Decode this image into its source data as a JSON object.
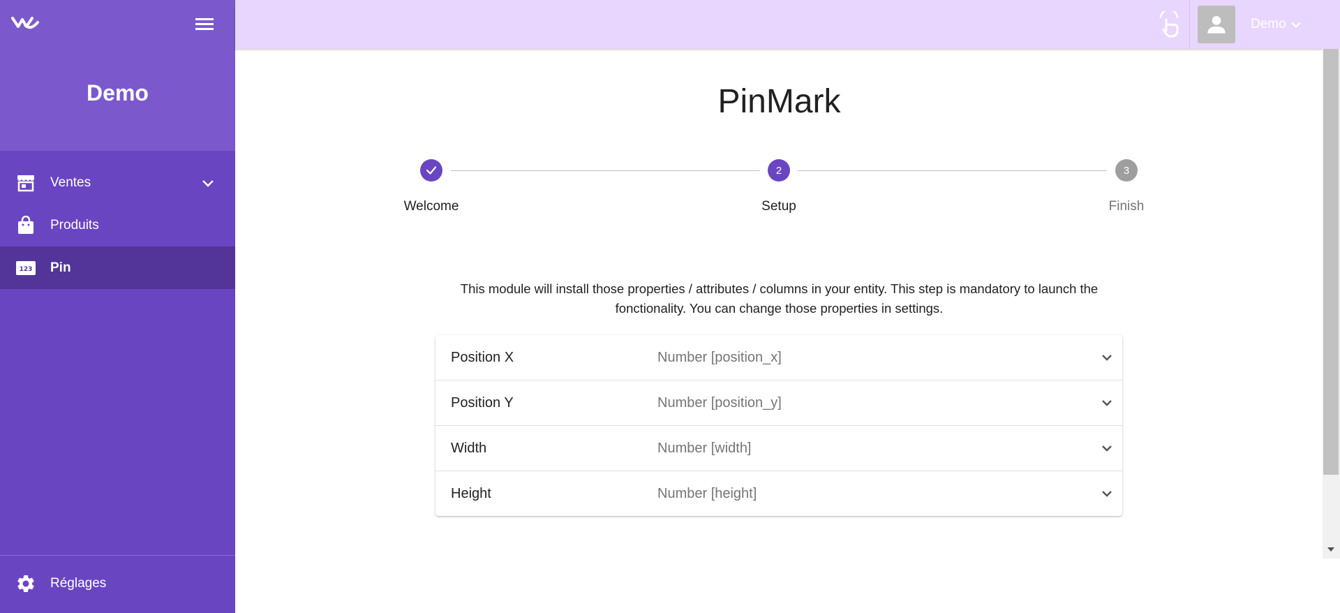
{
  "sidebar": {
    "brand": "Demo",
    "items": [
      {
        "label": "Ventes",
        "icon": "store-icon",
        "expandable": true
      },
      {
        "label": "Produits",
        "icon": "shopping-bag-icon"
      },
      {
        "label": "Pin",
        "icon": "numbers-123-icon",
        "active": true
      }
    ],
    "settings_label": "Réglages"
  },
  "topbar": {
    "user_name": "Demo"
  },
  "page": {
    "title": "PinMark"
  },
  "stepper": {
    "steps": [
      {
        "label": "Welcome",
        "state": "done"
      },
      {
        "label": "Setup",
        "number": "2",
        "state": "current"
      },
      {
        "label": "Finish",
        "number": "3",
        "state": "pending"
      }
    ]
  },
  "intro_text": "This module will install those properties / attributes / columns in your entity. This step is mandatory to launch the fonctionality. You can change those properties in settings.",
  "properties": [
    {
      "name": "Position X",
      "value": "Number [position_x]"
    },
    {
      "name": "Position Y",
      "value": "Number [position_y]"
    },
    {
      "name": "Width",
      "value": "Number [width]"
    },
    {
      "name": "Height",
      "value": "Number [height]"
    }
  ],
  "colors": {
    "sidebar": "#6a45c2",
    "sidebar_header": "#7b59cc",
    "sidebar_active": "#533599",
    "topbar": "#e8d6fe",
    "accent": "#6a45c2",
    "step_pending": "#9e9e9e"
  }
}
